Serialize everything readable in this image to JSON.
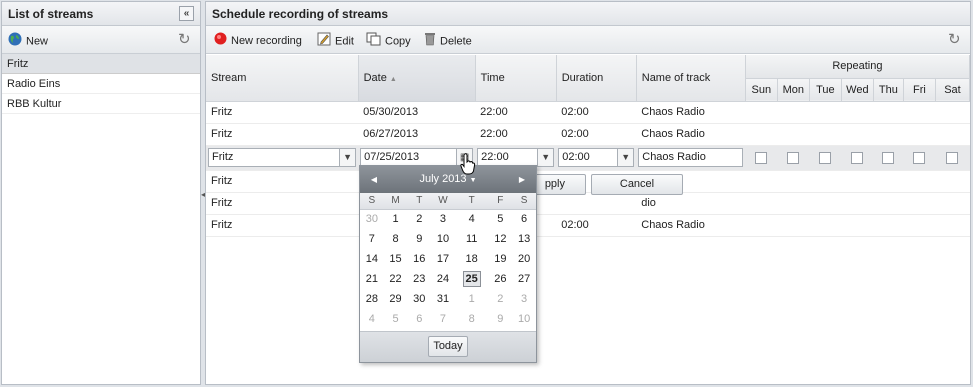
{
  "left_panel": {
    "title": "List of streams",
    "collapse_glyph": "«",
    "toolbar": {
      "new_label": "New"
    },
    "streams": [
      {
        "name": "Fritz",
        "selected": true
      },
      {
        "name": "Radio Eins",
        "selected": false
      },
      {
        "name": "RBB Kultur",
        "selected": false
      }
    ]
  },
  "right_panel": {
    "title": "Schedule recording of streams",
    "toolbar": {
      "new_recording_label": "New recording",
      "edit_label": "Edit",
      "copy_label": "Copy",
      "delete_label": "Delete"
    },
    "columns": {
      "stream": "Stream",
      "date": "Date",
      "time": "Time",
      "duration": "Duration",
      "name_of_track": "Name of track",
      "repeating": "Repeating",
      "days": [
        "Sun",
        "Mon",
        "Tue",
        "Wed",
        "Thu",
        "Fri",
        "Sat"
      ]
    },
    "rows": [
      {
        "stream": "Fritz",
        "date": "05/30/2013",
        "time": "22:00",
        "duration": "02:00",
        "track": "Chaos Radio"
      },
      {
        "stream": "Fritz",
        "date": "06/27/2013",
        "time": "22:00",
        "duration": "02:00",
        "track": "Chaos Radio"
      }
    ],
    "editor_row": {
      "stream": "Fritz",
      "date": "07/25/2013",
      "time": "22:00",
      "duration": "02:00",
      "track": "Chaos Radio"
    },
    "below_rows": [
      {
        "stream": "Fritz",
        "track_tail": "dio"
      },
      {
        "stream": "Fritz",
        "track_tail": "dio"
      },
      {
        "stream": "Fritz",
        "duration": "02:00",
        "track": "Chaos Radio"
      }
    ],
    "editor_buttons": {
      "apply_partial": "pply",
      "cancel": "Cancel"
    }
  },
  "date_picker": {
    "month_label": "July 2013",
    "weekday_headers": [
      "S",
      "M",
      "T",
      "W",
      "T",
      "F",
      "S"
    ],
    "weeks": [
      [
        "30",
        "1",
        "2",
        "3",
        "4",
        "5",
        "6"
      ],
      [
        "7",
        "8",
        "9",
        "10",
        "11",
        "12",
        "13"
      ],
      [
        "14",
        "15",
        "16",
        "17",
        "18",
        "19",
        "20"
      ],
      [
        "21",
        "22",
        "23",
        "24",
        "25",
        "26",
        "27"
      ],
      [
        "28",
        "29",
        "30",
        "31",
        "1",
        "2",
        "3"
      ],
      [
        "4",
        "5",
        "6",
        "7",
        "8",
        "9",
        "10"
      ]
    ],
    "selected_day": "25",
    "today_label": "Today"
  },
  "colors": {
    "record_red": "#e02020",
    "header_gray": "#7d838a"
  }
}
